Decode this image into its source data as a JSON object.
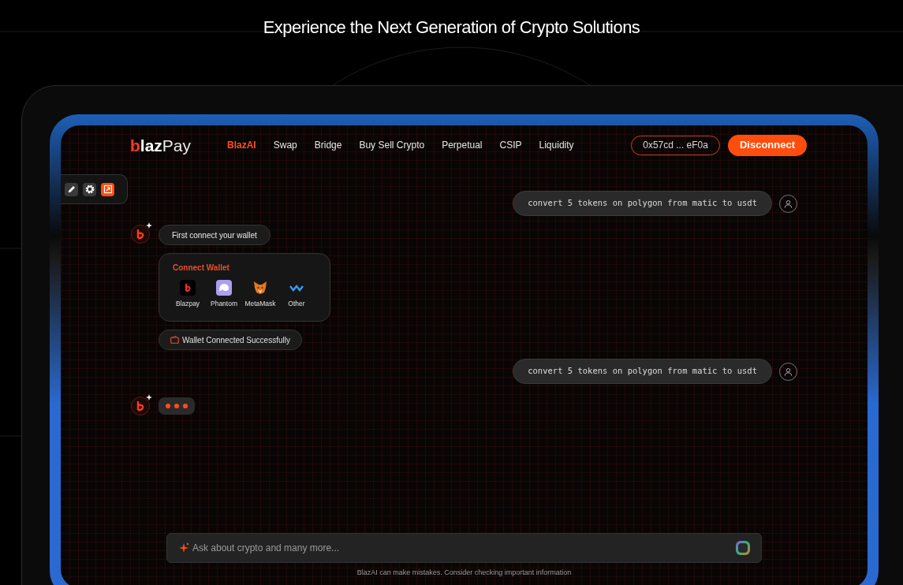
{
  "headline": "Experience the Next Generation of Crypto Solutions",
  "logo": {
    "mark": "b",
    "bold": "laz",
    "light": "Pay"
  },
  "nav": [
    {
      "label": "BlazAI",
      "selected": true
    },
    {
      "label": "Swap",
      "selected": false
    },
    {
      "label": "Bridge",
      "selected": false
    },
    {
      "label": "Buy Sell Crypto",
      "selected": false
    },
    {
      "label": "Perpetual",
      "selected": false
    },
    {
      "label": "CSIP",
      "selected": false
    },
    {
      "label": "Liquidity",
      "selected": false
    }
  ],
  "wallet_address": "0x57cd ... eF0a",
  "disconnect_button": "Disconnect",
  "toolbar": [
    {
      "kind": "edit",
      "selected": false
    },
    {
      "kind": "settings",
      "selected": false
    },
    {
      "kind": "expand",
      "selected": true
    }
  ],
  "messages": [
    {
      "kind": "user",
      "text": "convert 5 tokens on polygon from matic to usdt"
    },
    {
      "kind": "bot",
      "items": [
        {
          "kind": "text",
          "text": "First connect your wallet"
        },
        {
          "kind": "wallets",
          "title": "Connect Wallet",
          "wallets": [
            {
              "kind": "blazpay",
              "label": "Blazpay"
            },
            {
              "kind": "phantom",
              "label": "Phantom"
            },
            {
              "kind": "metamask",
              "label": "MetaMask"
            },
            {
              "kind": "other",
              "label": "Other"
            }
          ]
        },
        {
          "kind": "status",
          "text": "Wallet Connected Successfully"
        }
      ]
    },
    {
      "kind": "user",
      "text": "convert 5 tokens on polygon from matic to usdt"
    },
    {
      "kind": "typing"
    }
  ],
  "input": {
    "placeholder": "Ask about crypto and many more..."
  },
  "disclaimer": "BlazAI can make mistakes. Consider checking important information"
}
